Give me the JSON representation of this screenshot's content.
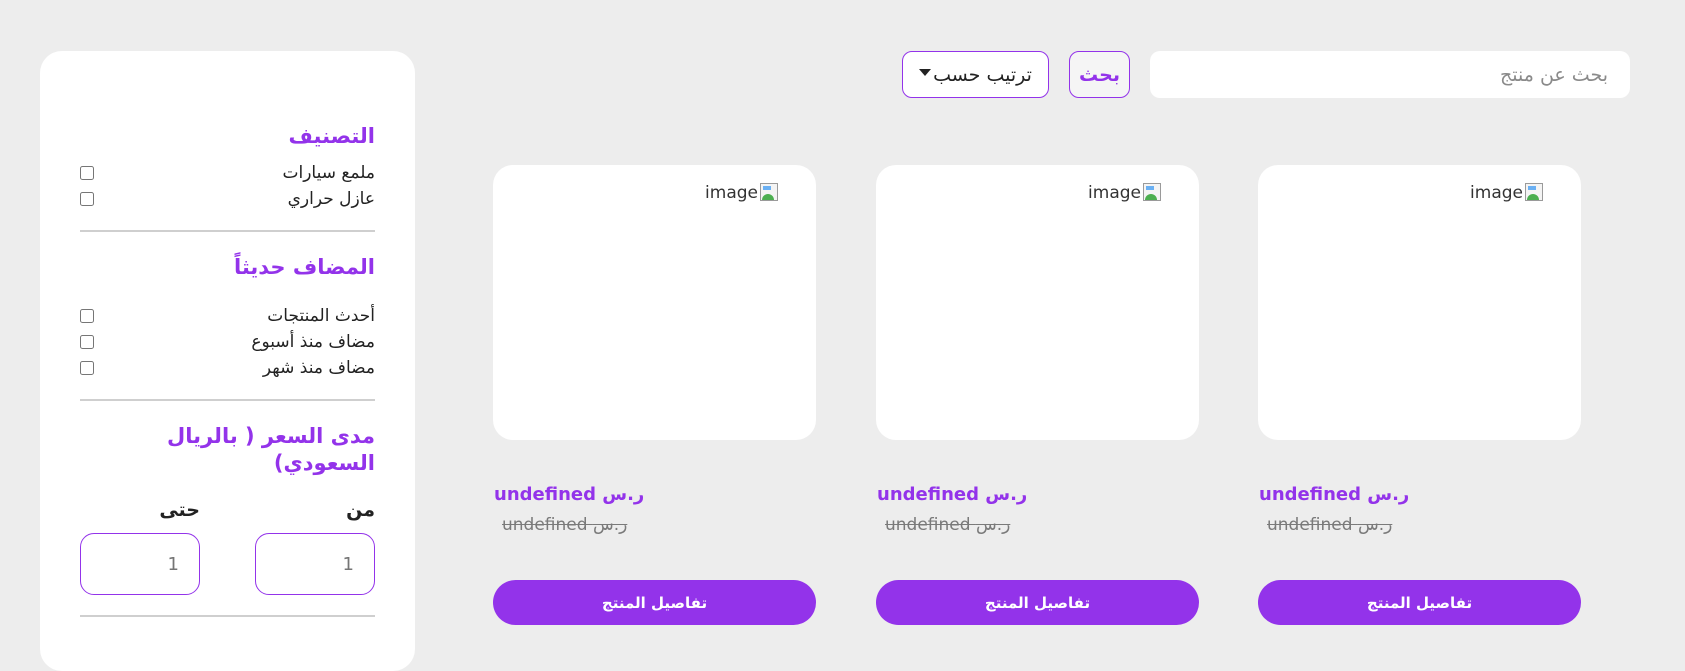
{
  "search": {
    "placeholder": "بحث عن منتج",
    "button_label": "بحث"
  },
  "sort": {
    "label": "ترتيب حسب",
    "icon": "caret-down-icon"
  },
  "sidebar": {
    "category": {
      "title": "التصنيف",
      "items": [
        {
          "label": "ملمع سيارات",
          "checked": false
        },
        {
          "label": "عازل حراري",
          "checked": false
        }
      ]
    },
    "recent": {
      "title": "المضاف حديثاً",
      "items": [
        {
          "label": "أحدث المنتجات",
          "checked": false
        },
        {
          "label": "مضاف منذ أسبوع",
          "checked": false
        },
        {
          "label": "مضاف منذ شهر",
          "checked": false
        }
      ]
    },
    "price_range": {
      "title": "مدى السعر ( بالريال السعودي)",
      "from_label": "من",
      "to_label": "حتى",
      "from_placeholder": "1",
      "to_placeholder": "1"
    }
  },
  "products": [
    {
      "image_alt": "image",
      "price": "undefined ر.س",
      "old_price": "undefined ر.س",
      "button_label": "تفاصيل المنتج"
    },
    {
      "image_alt": "image",
      "price": "undefined ر.س",
      "old_price": "undefined ر.س",
      "button_label": "تفاصيل المنتج"
    },
    {
      "image_alt": "image",
      "price": "undefined ر.س",
      "old_price": "undefined ر.س",
      "button_label": "تفاصيل المنتج"
    }
  ],
  "colors": {
    "accent": "#9333ea",
    "background": "#ededed",
    "card": "#ffffff"
  }
}
